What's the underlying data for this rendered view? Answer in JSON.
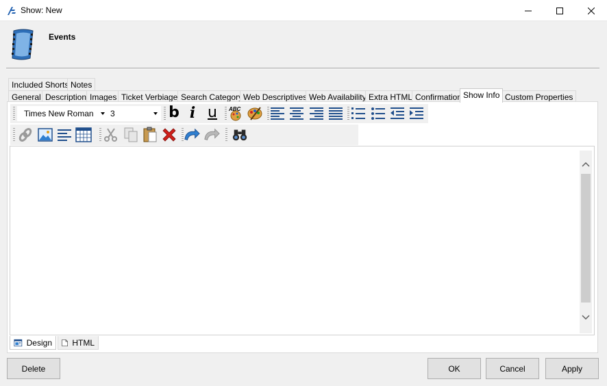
{
  "window": {
    "title": "Show: New"
  },
  "header": {
    "title": "Events"
  },
  "tabs_row1": [
    {
      "label": "Included Shorts"
    },
    {
      "label": "Notes"
    }
  ],
  "tabs_row2": [
    {
      "label": "General"
    },
    {
      "label": "Description"
    },
    {
      "label": "Images"
    },
    {
      "label": "Ticket Verbiage"
    },
    {
      "label": "Search Category"
    },
    {
      "label": "Web Descriptives"
    },
    {
      "label": "Web Availability"
    },
    {
      "label": "Extra HTML"
    },
    {
      "label": "Confirmation"
    },
    {
      "label": "Show Info"
    },
    {
      "label": "Custom Properties"
    }
  ],
  "active_tab": "Show Info",
  "toolbar": {
    "font_name": "Times New Roman",
    "font_size": "3",
    "bold_label": "b",
    "italic_label": "i",
    "underline_label": "u",
    "spell_label": "ABC"
  },
  "mode_tabs": [
    {
      "label": "Design"
    },
    {
      "label": "HTML"
    }
  ],
  "buttons": {
    "delete": "Delete",
    "ok": "OK",
    "cancel": "Cancel",
    "apply": "Apply"
  },
  "colors": {
    "accent_blue": "#2b6cb0",
    "delete_red": "#d0201a",
    "line_blue": "#1f4e8c"
  }
}
